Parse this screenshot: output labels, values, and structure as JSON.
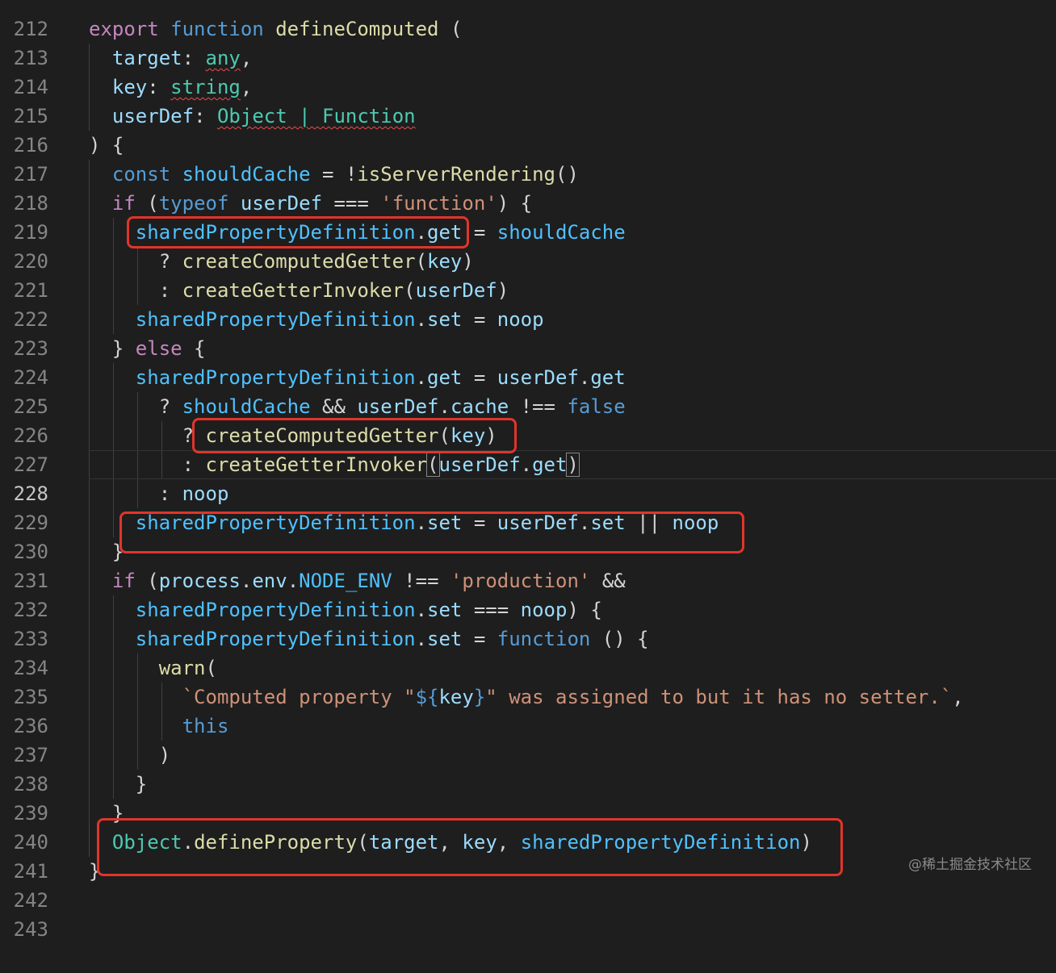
{
  "editor": {
    "line_numbers": [
      "212",
      "213",
      "214",
      "215",
      "216",
      "217",
      "218",
      "219",
      "220",
      "221",
      "222",
      "223",
      "224",
      "225",
      "226",
      "227",
      "228",
      "229",
      "230",
      "231",
      "232",
      "233",
      "234",
      "235",
      "236",
      "237",
      "238",
      "239",
      "240",
      "241",
      "242",
      "243"
    ],
    "current_line": "228"
  },
  "watermark": "@稀土掘金技术社区"
}
